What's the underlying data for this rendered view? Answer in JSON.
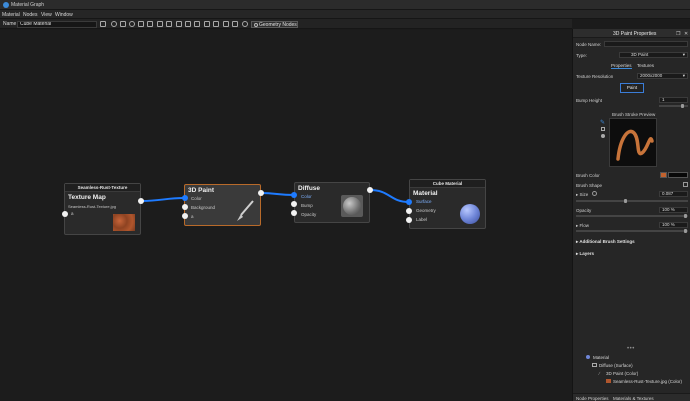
{
  "window": {
    "title": "Material Graph"
  },
  "menu": [
    "Material",
    "Nodes",
    "View",
    "Window"
  ],
  "toolbar": {
    "name_label": "Name",
    "name_value": "Cube Material",
    "geometry_nodes_label": "Geometry Nodes"
  },
  "nodes": {
    "texture": {
      "header": "Seamless-Rust-Texture",
      "title": "Texture Map",
      "file": "Seamless-Rust-Texture.jpg",
      "port_a": "a"
    },
    "paint": {
      "title": "3D Paint",
      "ports": [
        "Color",
        "Background",
        "a"
      ]
    },
    "diffuse": {
      "title": "Diffuse",
      "ports": [
        "Color",
        "Bump",
        "Opacity"
      ]
    },
    "material": {
      "header": "Cube Material",
      "title": "Material",
      "ports": [
        "Surface",
        "Geometry",
        "Label"
      ]
    }
  },
  "panel": {
    "title": "3D Paint Properties",
    "node_name_label": "Node Name:",
    "type_label": "Type:",
    "type_value": "3D Paint",
    "tabs": [
      "Properties",
      "Textures"
    ],
    "texture_resolution_label": "Texture Resolution",
    "texture_resolution_value": "2000x2000",
    "paint_button": "Paint",
    "bump_height_label": "Bump Height",
    "bump_height_value": "1",
    "brush_preview_label": "Brush Stroke Preview",
    "brush_color_label": "Brush Color",
    "brush_shape_label": "Brush Shape",
    "size_label": "Size",
    "size_value": "0.087",
    "opacity_label": "Opacity",
    "opacity_value": "100 %",
    "flow_label": "Flow",
    "flow_value": "100 %",
    "additional_label": "Additional Brush Settings",
    "layers_label": "Layers",
    "tree": [
      "Material",
      "Diffuse (Surface)",
      "3D Paint (Color)",
      "Seamless-Rust-Texture.jpg (Color)"
    ],
    "bottom_tabs": [
      "Node Properties",
      "Materials & Textures"
    ]
  },
  "colors": {
    "accent": "#1e7bff",
    "paint_border": "#b86a2a",
    "stroke": "#c8743a"
  }
}
